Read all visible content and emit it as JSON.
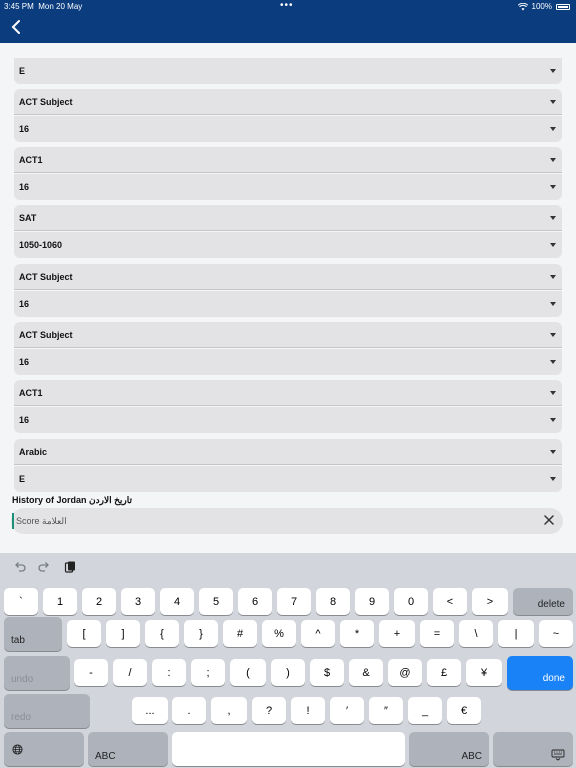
{
  "status_bar": {
    "time": "3:45 PM",
    "date": "Mon 20 May",
    "battery": "100%"
  },
  "form": {
    "rows": [
      {
        "label": "E"
      },
      {
        "label": "ACT Subject"
      },
      {
        "label": "16"
      },
      {
        "label": "ACT1"
      },
      {
        "label": "16"
      },
      {
        "label": "SAT"
      },
      {
        "label": "1050-1060"
      },
      {
        "label": "ACT Subject"
      },
      {
        "label": "16"
      },
      {
        "label": "ACT Subject"
      },
      {
        "label": "16"
      },
      {
        "label": "ACT1"
      },
      {
        "label": "16"
      },
      {
        "label": "Arabic"
      },
      {
        "label": "E"
      }
    ],
    "section_label": "History of Jordan تاريخ الاردن",
    "score_placeholder": "Score العلامة"
  },
  "keyboard": {
    "row1": [
      "`",
      "1",
      "2",
      "3",
      "4",
      "5",
      "6",
      "7",
      "8",
      "9",
      "0",
      "<",
      ">"
    ],
    "delete": "delete",
    "tab": "tab",
    "row2": [
      "[",
      "]",
      "{",
      "}",
      "#",
      "%",
      "^",
      "*",
      "+",
      "=",
      "\\",
      "|",
      "~"
    ],
    "undo": "undo",
    "row3": [
      "-",
      "/",
      ":",
      ";",
      "(",
      ")",
      "$",
      "&",
      "@",
      "£",
      "¥"
    ],
    "done": "done",
    "redo": "redo",
    "row4": [
      "...",
      ".",
      ",",
      "?",
      "!",
      "′",
      "″",
      "_",
      "€"
    ],
    "abc_left": "ABC",
    "abc_right": "ABC"
  },
  "colors": {
    "nav": "#0a3c7e",
    "accent": "#1a82f7"
  }
}
